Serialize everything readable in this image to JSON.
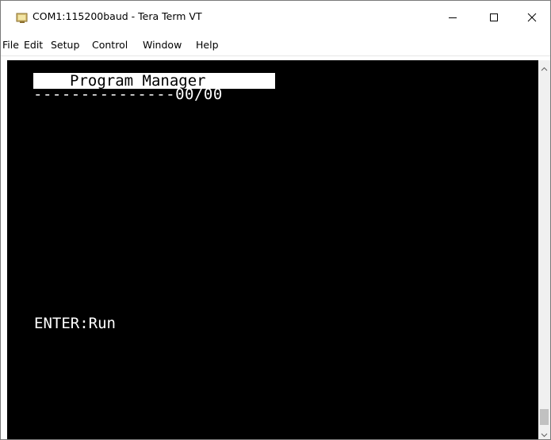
{
  "window": {
    "title": "COM1:115200baud - Tera Term VT"
  },
  "menu": {
    "items": [
      "File",
      "Edit",
      "Setup",
      "Control",
      "Window",
      "Help"
    ]
  },
  "terminal": {
    "header": "Program Manager",
    "separator": "---------------00/00",
    "hint": "ENTER:Run"
  },
  "icons": {
    "app": "tera-term-icon",
    "minimize": "minimize-icon",
    "maximize": "maximize-icon",
    "close": "close-icon",
    "scroll_up": "chevron-up-icon",
    "scroll_down": "chevron-down-icon"
  },
  "colors": {
    "terminal_bg": "#000000",
    "terminal_fg": "#ffffff",
    "window_bg": "#ffffff"
  }
}
